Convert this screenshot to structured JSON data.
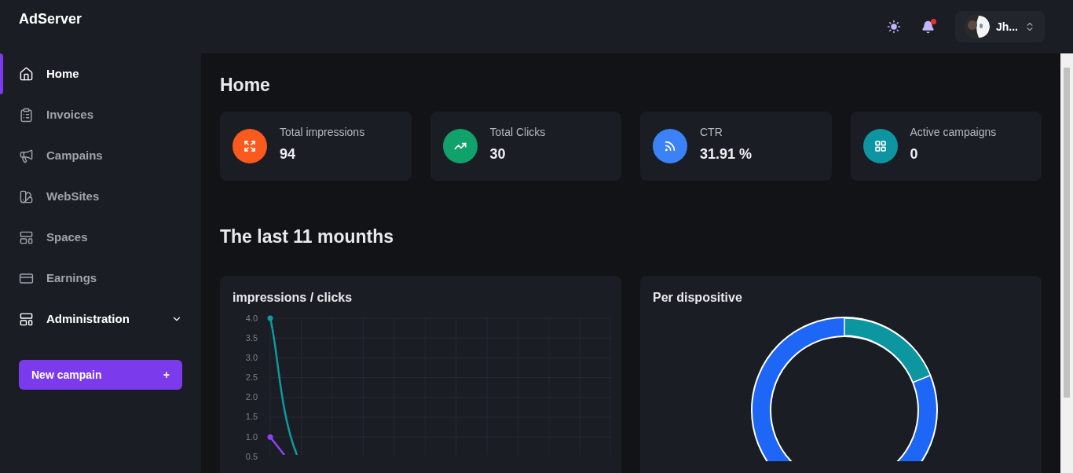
{
  "brand": "AdServer",
  "topbar": {
    "user": {
      "name": "Jh..."
    },
    "notifications": {
      "unread": true
    }
  },
  "sidebar": {
    "items": [
      {
        "label": "Home",
        "selected": true
      },
      {
        "label": "Invoices",
        "selected": false
      },
      {
        "label": "Campains",
        "selected": false
      },
      {
        "label": "WebSites",
        "selected": false
      },
      {
        "label": "Spaces",
        "selected": false
      },
      {
        "label": "Earnings",
        "selected": false
      },
      {
        "label": "Administration",
        "selected": false,
        "expandable": true
      }
    ],
    "new_button": {
      "label": "New campain",
      "symbol": "+"
    }
  },
  "page_title": "Home",
  "stats": [
    {
      "label": "Total impressions",
      "value": "94",
      "color": "#fa5a1e"
    },
    {
      "label": "Total Clicks",
      "value": "30",
      "color": "#10a26a"
    },
    {
      "label": "CTR",
      "value": "31.91 %",
      "color": "#3b82f6"
    },
    {
      "label": "Active campaigns",
      "value": "0",
      "color": "#0e95a2"
    }
  ],
  "section_title": "The last 11 mounths",
  "line_card": {
    "title": "impressions / clicks",
    "axis_labels": [
      "4.0",
      "3.5",
      "3.0",
      "2.5",
      "2.0",
      "1.5",
      "1.0",
      "0.5"
    ]
  },
  "donut_card": {
    "title": "Per dispositive"
  }
}
